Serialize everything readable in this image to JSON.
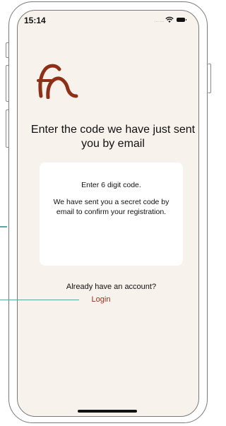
{
  "status_bar": {
    "time": "15:14",
    "signal_dots": "……",
    "icons": [
      "wifi-icon",
      "battery-icon"
    ]
  },
  "brand": {
    "logo_icon": "brand-logo-icon",
    "logo_color": "#8e2f18"
  },
  "screen": {
    "title": "Enter the code we have just sent you by email",
    "card": {
      "instruction": "Enter 6 digit code.",
      "message": "We have sent you a secret code by email to confirm your registration."
    },
    "account_prompt": "Already have an account?",
    "login_link": "Login"
  },
  "colors": {
    "background": "#f8f2ec",
    "card": "#ffffff",
    "accent": "#8e3520",
    "annotation": "#5aa9a2"
  }
}
